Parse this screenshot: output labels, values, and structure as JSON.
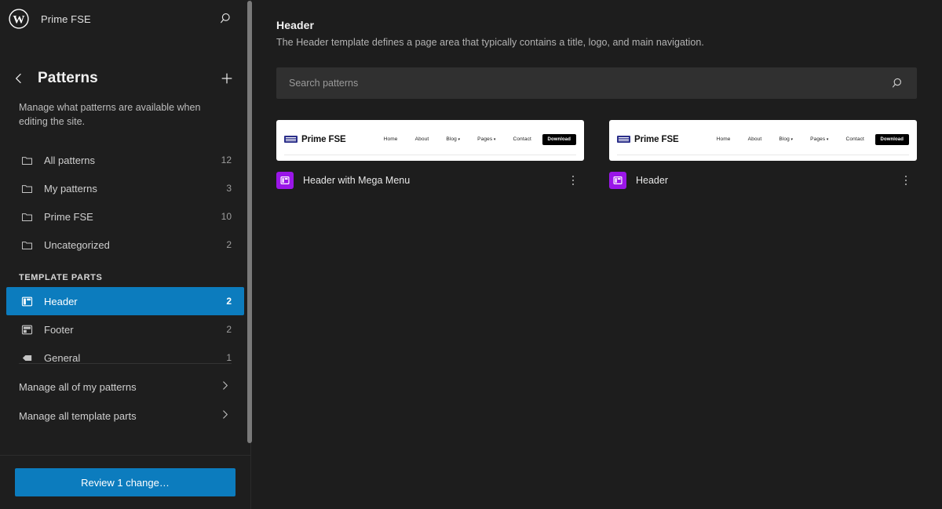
{
  "sidebar": {
    "site_title": "Prime FSE",
    "logo_icon": "wordpress-logo-icon",
    "search_icon": "search-icon",
    "back_icon": "chevron-left-icon",
    "add_icon": "plus-icon",
    "panel_title": "Patterns",
    "panel_description": "Manage what patterns are available when editing the site.",
    "categories": [
      {
        "label": "All patterns",
        "count": "12",
        "icon": "folder-icon"
      },
      {
        "label": "My patterns",
        "count": "3",
        "icon": "folder-icon"
      },
      {
        "label": "Prime FSE",
        "count": "10",
        "icon": "folder-icon"
      },
      {
        "label": "Uncategorized",
        "count": "2",
        "icon": "folder-icon"
      }
    ],
    "template_parts_label": "TEMPLATE PARTS",
    "template_parts": [
      {
        "label": "Header",
        "count": "2",
        "icon": "header-layout-icon",
        "active": true
      },
      {
        "label": "Footer",
        "count": "2",
        "icon": "footer-layout-icon",
        "active": false
      },
      {
        "label": "General",
        "count": "1",
        "icon": "general-layout-icon",
        "active": false
      }
    ],
    "manage_links": [
      {
        "label": "Manage all of my patterns",
        "icon": "chevron-right-icon"
      },
      {
        "label": "Manage all template parts",
        "icon": "chevron-right-icon"
      }
    ],
    "review_button": "Review 1 change…"
  },
  "main": {
    "title": "Header",
    "description": "The Header template defines a page area that typically contains a title, logo, and main navigation.",
    "search": {
      "placeholder": "Search patterns",
      "value": "",
      "icon": "search-icon"
    },
    "cards": [
      {
        "title": "Header with Mega Menu",
        "icon": "header-layout-icon",
        "more_icon": "kebab-menu-icon",
        "preview": {
          "logo_text": "Prime FSE",
          "nav": [
            {
              "label": "Home",
              "caret": false
            },
            {
              "label": "About",
              "caret": false
            },
            {
              "label": "Blog",
              "caret": true
            },
            {
              "label": "Pages",
              "caret": true
            },
            {
              "label": "Contact",
              "caret": false
            }
          ],
          "button": "Download"
        }
      },
      {
        "title": "Header",
        "icon": "header-layout-icon",
        "more_icon": "kebab-menu-icon",
        "preview": {
          "logo_text": "Prime FSE",
          "nav": [
            {
              "label": "Home",
              "caret": false
            },
            {
              "label": "About",
              "caret": false
            },
            {
              "label": "Blog",
              "caret": true
            },
            {
              "label": "Pages",
              "caret": true
            },
            {
              "label": "Contact",
              "caret": false
            }
          ],
          "button": "Download"
        }
      }
    ]
  },
  "colors": {
    "accent": "#0c7cbe",
    "sidebar_bg": "#1e1e1e",
    "main_bg": "#1d1d1d",
    "pattern_icon": "#9a16e8",
    "logo_mark": "#2b2f8a"
  }
}
